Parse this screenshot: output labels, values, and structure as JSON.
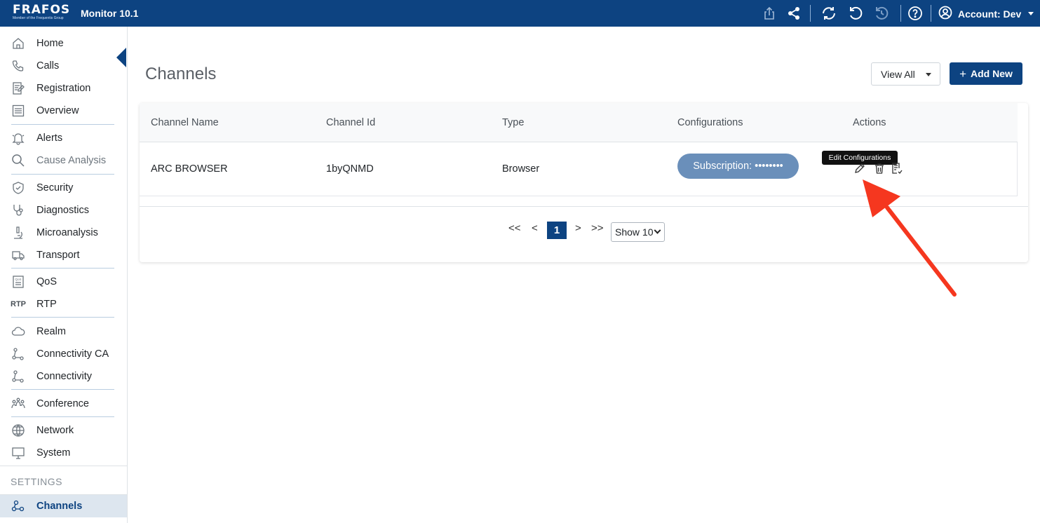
{
  "topbar": {
    "logo_text": "FRAFOS",
    "logo_subtext": "Member of the Frequentis Group",
    "app_title": "Monitor 10.1",
    "account_label": "Account: Dev",
    "icons": [
      "export-icon",
      "share-icon",
      "sync-icon",
      "refresh-icon",
      "history-icon",
      "help-icon",
      "user-circle-icon"
    ]
  },
  "sidebar": {
    "items": [
      {
        "label": "Home",
        "icon": "home-icon"
      },
      {
        "label": "Calls",
        "icon": "phone-icon"
      },
      {
        "label": "Registration",
        "icon": "registration-icon"
      },
      {
        "label": "Overview",
        "icon": "overview-icon"
      },
      {
        "label": "Alerts",
        "icon": "bell-icon"
      },
      {
        "label": "Cause Analysis",
        "icon": "search-icon"
      },
      {
        "label": "Security",
        "icon": "shield-icon"
      },
      {
        "label": "Diagnostics",
        "icon": "stethoscope-icon"
      },
      {
        "label": "Microanalysis",
        "icon": "microscope-icon"
      },
      {
        "label": "Transport",
        "icon": "truck-icon"
      },
      {
        "label": "QoS",
        "icon": "qos-icon"
      },
      {
        "label": "RTP",
        "icon": "rtp-icon"
      },
      {
        "label": "Realm",
        "icon": "cloud-icon"
      },
      {
        "label": "Connectivity CA",
        "icon": "connectivity-icon"
      },
      {
        "label": "Connectivity",
        "icon": "connectivity-icon"
      },
      {
        "label": "Conference",
        "icon": "people-icon"
      },
      {
        "label": "Network",
        "icon": "globe-icon"
      },
      {
        "label": "System",
        "icon": "monitor-icon"
      }
    ],
    "settings_heading": "SETTINGS",
    "active_item": {
      "label": "Channels",
      "icon": "channels-icon"
    },
    "rtp_icon_text": "RTP",
    "qos_icon_text": "QoS"
  },
  "main": {
    "title": "Channels",
    "view_all_label": "View All",
    "add_new_label": "Add New",
    "table": {
      "columns": [
        "Channel Name",
        "Channel Id",
        "Type",
        "Configurations",
        "Actions"
      ],
      "rows": [
        {
          "name": "ARC BROWSER",
          "id": "1byQNMD",
          "type": "Browser",
          "config": "Subscription: ••••••••"
        }
      ]
    },
    "tooltip": "Edit Configurations",
    "pager": {
      "first": "<<",
      "prev": "<",
      "current": "1",
      "next": ">",
      "last": ">>",
      "show": "Show 10"
    }
  },
  "colors": {
    "brand": "#0d4381",
    "pill": "#6a8fba",
    "annotation_arrow": "#f5371f"
  }
}
